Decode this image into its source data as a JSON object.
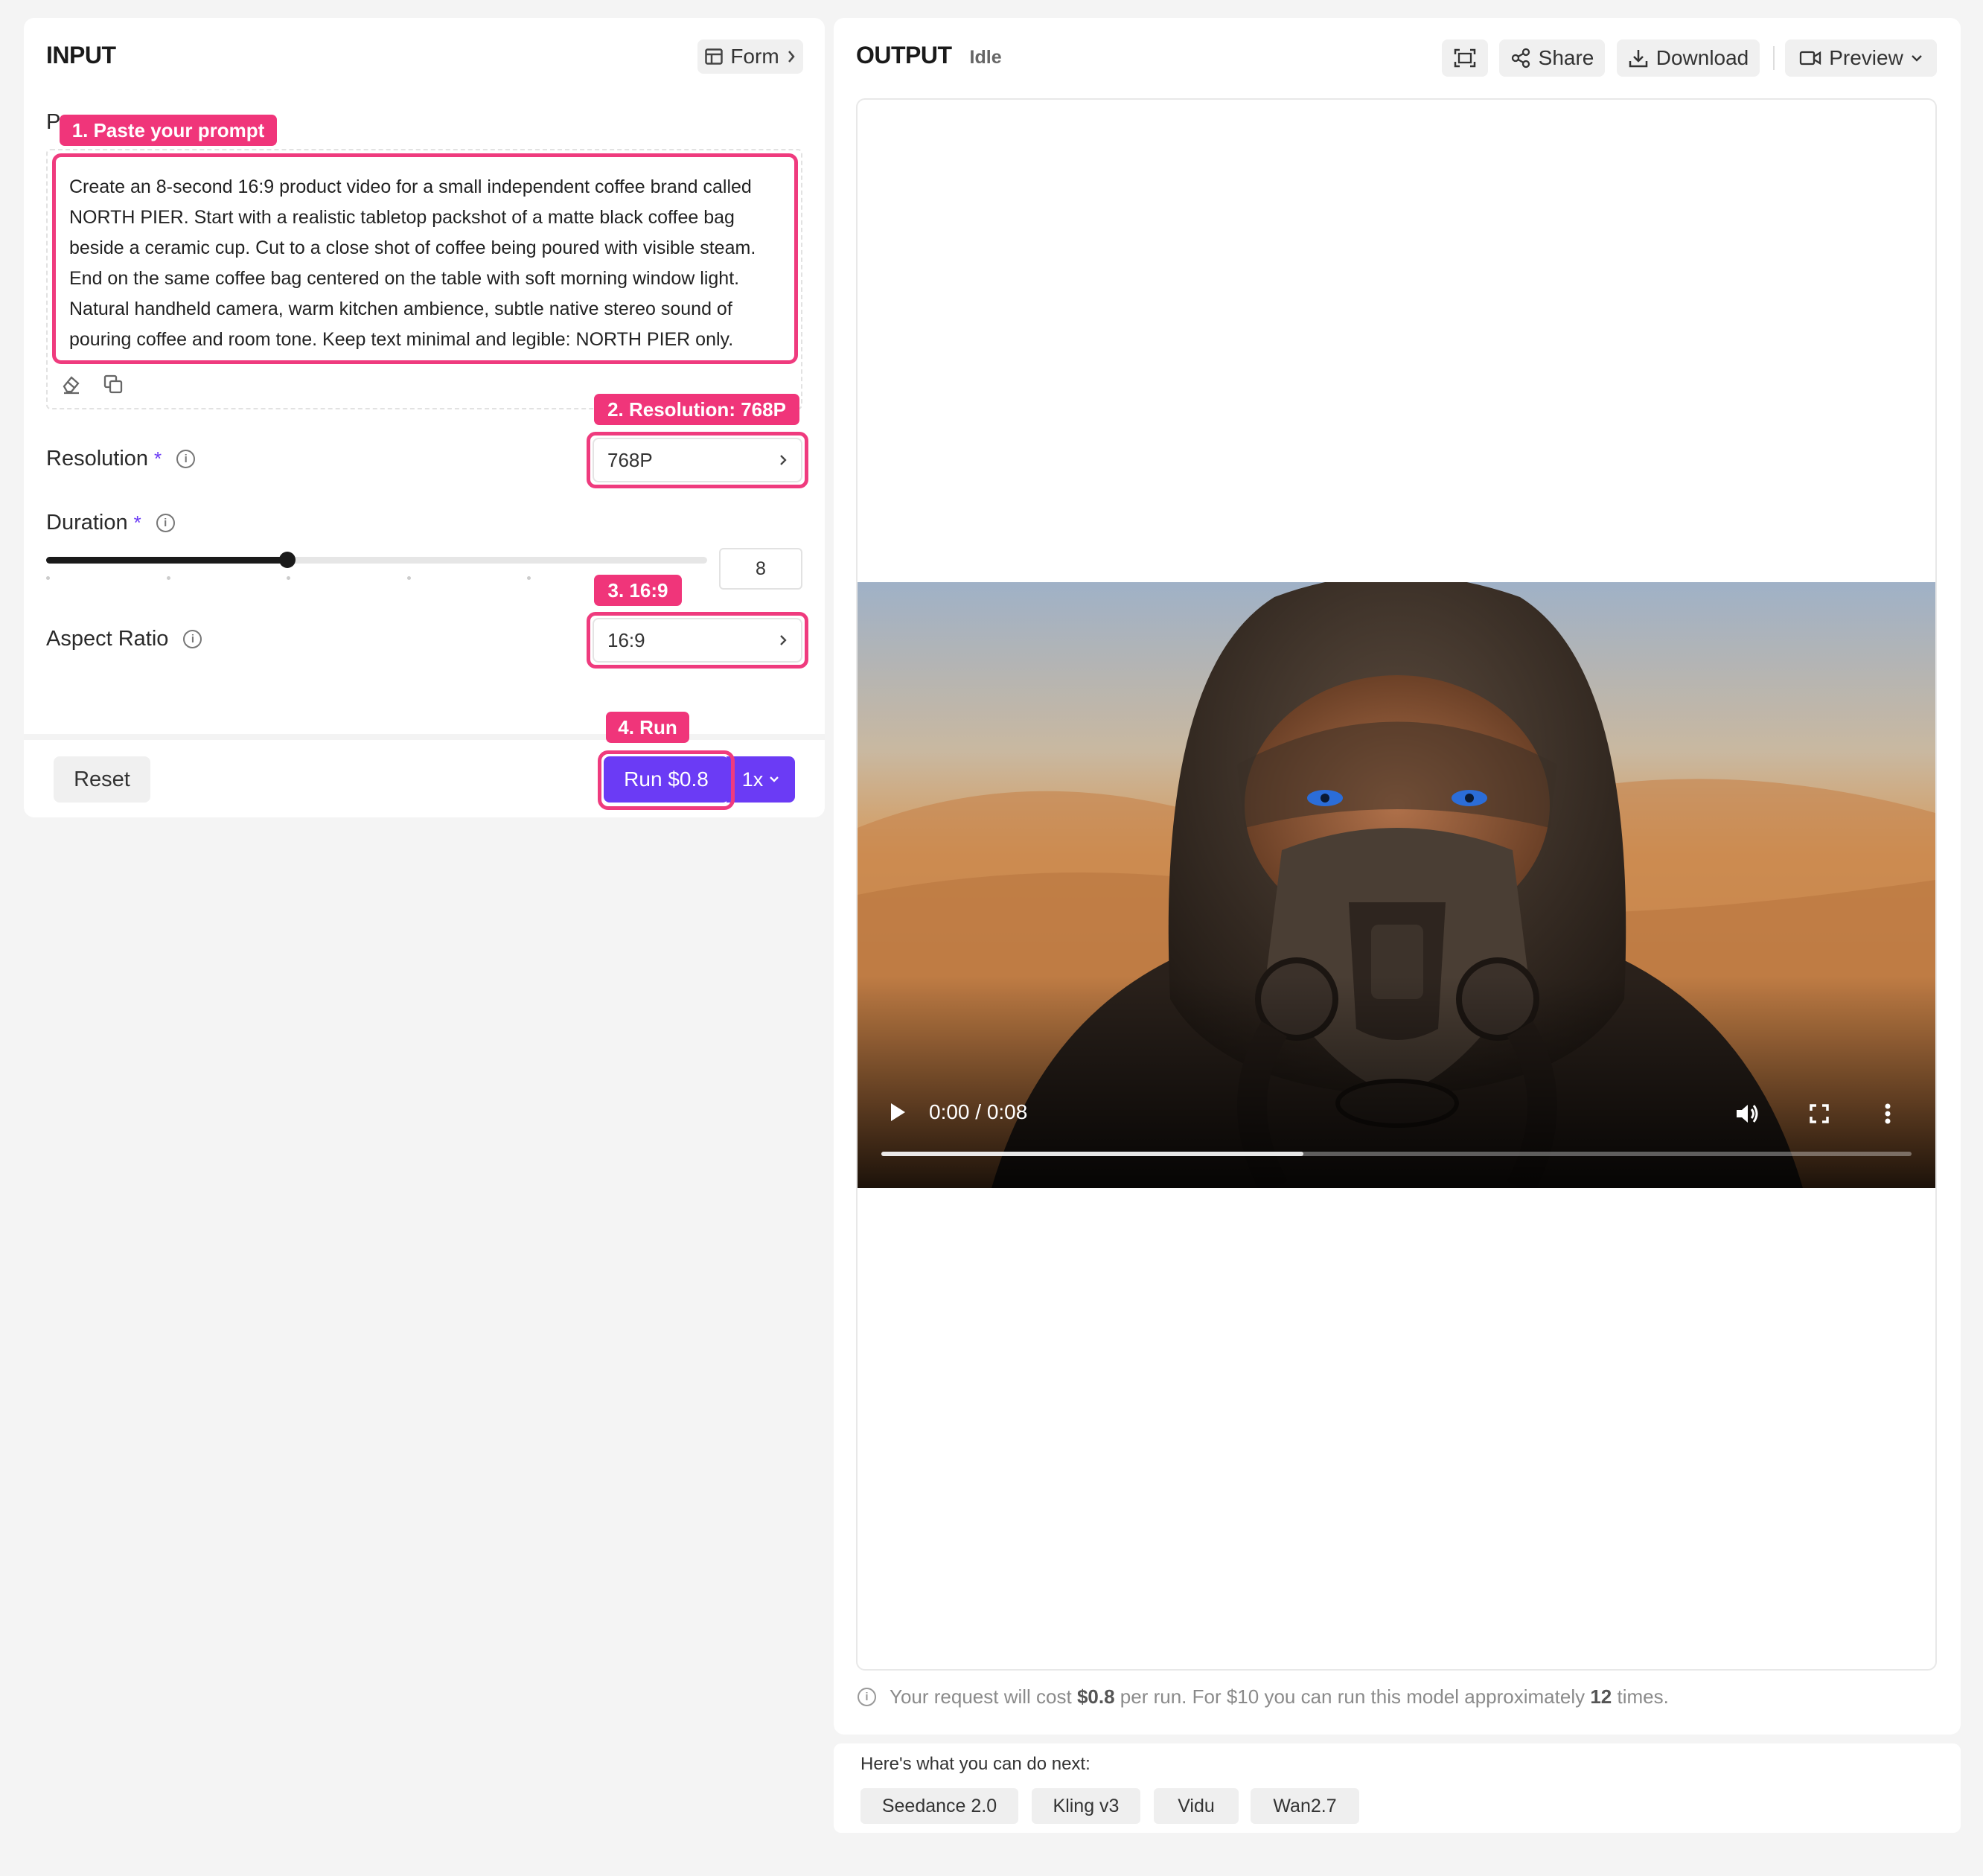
{
  "input_panel": {
    "title": "INPUT",
    "form_button_label": "Form",
    "prompt": {
      "label_partial": "P",
      "annotation": "1. Paste your prompt",
      "value": "Create an 8-second 16:9 product video for a small independent coffee brand called NORTH PIER. Start with a realistic tabletop packshot of a matte black coffee bag beside a ceramic cup. Cut to a close shot of coffee being poured with visible steam. End on the same coffee bag centered on the table with soft morning window light. Natural handheld camera, warm kitchen ambience, subtle native stereo sound of pouring coffee and room tone. Keep text minimal and legible: NORTH PIER only."
    },
    "resolution": {
      "label": "Resolution",
      "required_mark": "*",
      "annotation": "2. Resolution: 768P",
      "value": "768P"
    },
    "duration": {
      "label": "Duration",
      "required_mark": "*",
      "value": "8",
      "slider_fraction": 0.365
    },
    "aspect_ratio": {
      "label": "Aspect Ratio",
      "annotation": "3. 16:9",
      "value": "16:9"
    },
    "footer": {
      "reset_label": "Reset",
      "run_annotation": "4. Run",
      "run_label": "Run $0.8",
      "multiplier_label": "1x"
    }
  },
  "output_panel": {
    "title": "OUTPUT",
    "status": "Idle",
    "share_label": "Share",
    "download_label": "Download",
    "preview_label": "Preview",
    "video": {
      "time": "0:00 / 0:08",
      "progress_fraction": 0.41
    },
    "cost_note": {
      "prefix": "Your request will cost ",
      "cost": "$0.8",
      "middle": " per run. For $10 you can run this model approximately ",
      "count": "12",
      "suffix": " times."
    }
  },
  "next_panel": {
    "heading": "Here's what you can do next:",
    "chips": [
      "Seedance 2.0",
      "Kling v3",
      "Vidu",
      "Wan2.7"
    ]
  },
  "colors": {
    "accent": "#6b3bf5",
    "annotation": "#f0357a"
  }
}
